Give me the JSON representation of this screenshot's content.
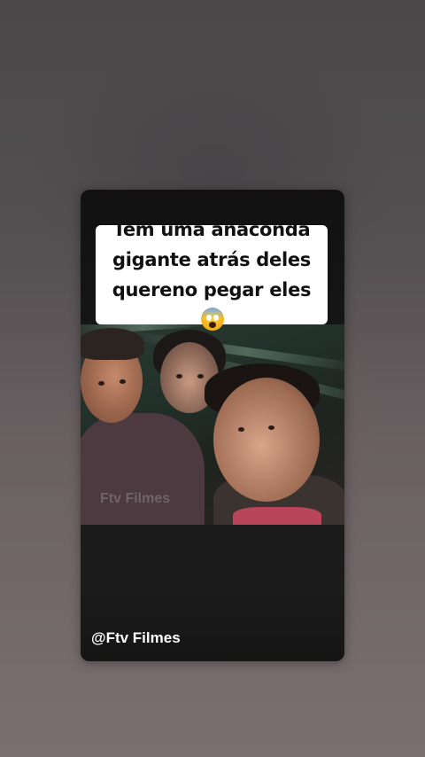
{
  "post": {
    "caption_line1": "Tem uma anaconda",
    "caption_line2": "gigante atrás deles",
    "caption_line3": "quereno pegar eles",
    "emoji_icon": "face-screaming-in-fear-icon"
  },
  "video": {
    "watermark": "Ftv Filmes",
    "username": "@Ftv Filmes"
  },
  "colors": {
    "background": "#565153",
    "card": "#151515",
    "caption_bg": "#ffffff",
    "caption_text": "#111111",
    "username_text": "#ffffff"
  }
}
